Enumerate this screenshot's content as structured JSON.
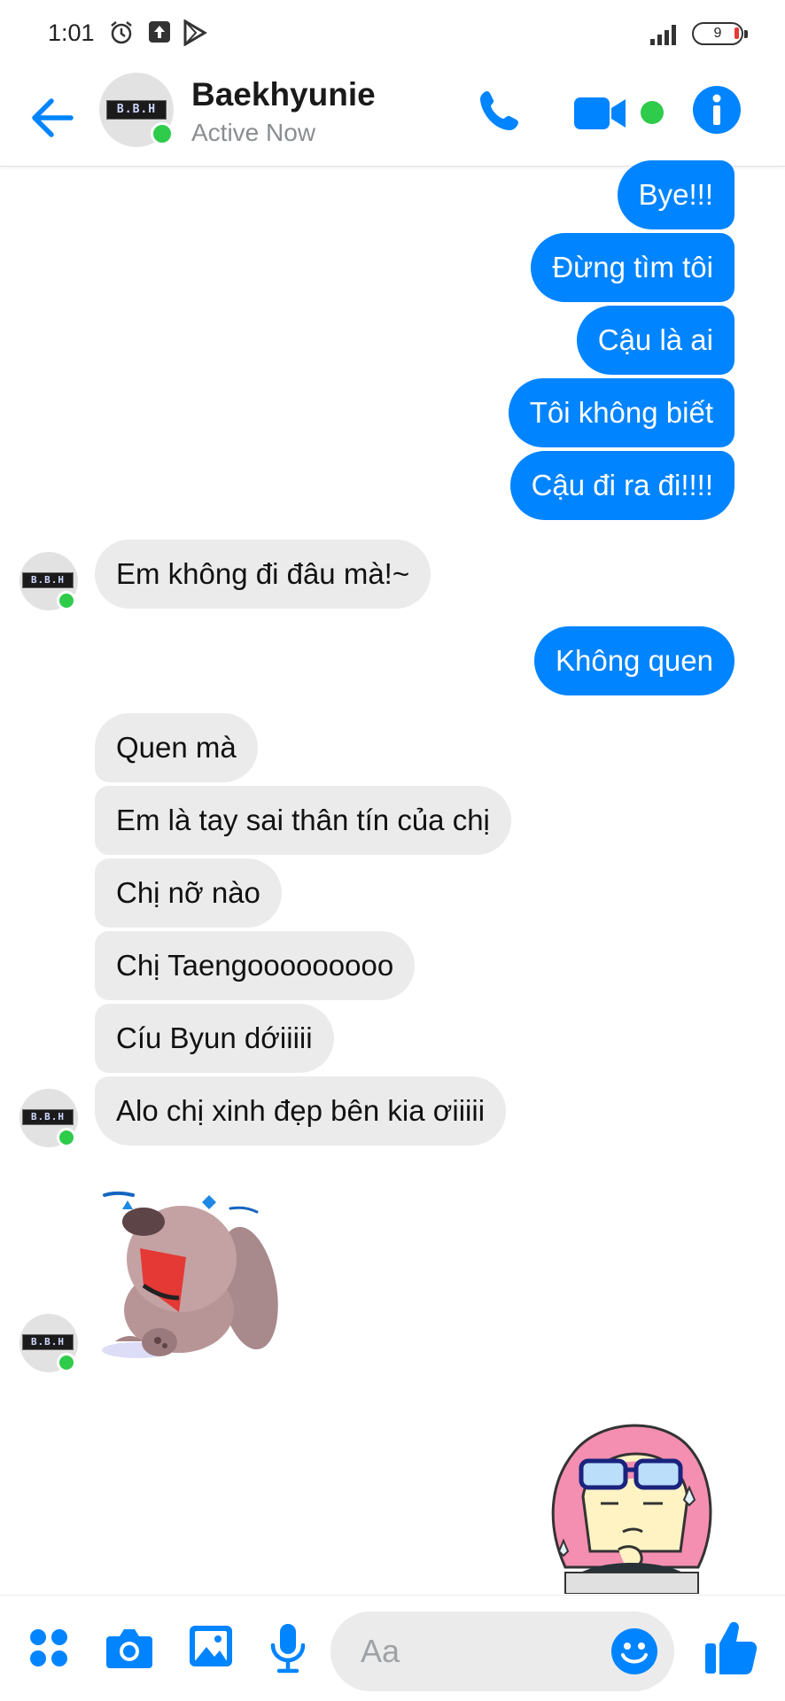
{
  "status_bar": {
    "time": "1:01",
    "battery_level": "9",
    "icons": [
      "alarm-icon",
      "upload-icon",
      "play-store-icon",
      "signal-icon",
      "battery-icon"
    ]
  },
  "header": {
    "contact_name": "Baekhyunie",
    "status": "Active Now",
    "avatar_text": "B.B.H",
    "accent_color": "#0084ff",
    "online_color": "#2fcb4a"
  },
  "messages": [
    {
      "side": "out",
      "text": "Bye!!!"
    },
    {
      "side": "out",
      "text": "Đừng tìm tôi"
    },
    {
      "side": "out",
      "text": "Cậu là ai"
    },
    {
      "side": "out",
      "text": "Tôi không biết"
    },
    {
      "side": "out",
      "text": "Cậu đi ra đi!!!!"
    },
    {
      "side": "in",
      "text": "Em không đi đâu mà!~"
    },
    {
      "side": "out",
      "text": "Không quen"
    },
    {
      "side": "in",
      "text": "Quen mà"
    },
    {
      "side": "in",
      "text": "Em là tay sai thân tín của chị"
    },
    {
      "side": "in",
      "text": "Chị nỡ nào"
    },
    {
      "side": "in",
      "text": "Chị Taengooooooooo"
    },
    {
      "side": "in",
      "text": "Cíu Byun dớiiiii"
    },
    {
      "side": "in",
      "text": "Alo chị xinh đẹp bên kia ơiiiii"
    }
  ],
  "stickers": [
    {
      "side": "in",
      "name": "crying-dog-sticker"
    },
    {
      "side": "out",
      "name": "thinking-girl-sticker"
    }
  ],
  "composer": {
    "placeholder": "Aa",
    "icons": [
      "apps-icon",
      "camera-icon",
      "gallery-icon",
      "microphone-icon",
      "emoji-icon",
      "thumbs-up-icon"
    ]
  }
}
